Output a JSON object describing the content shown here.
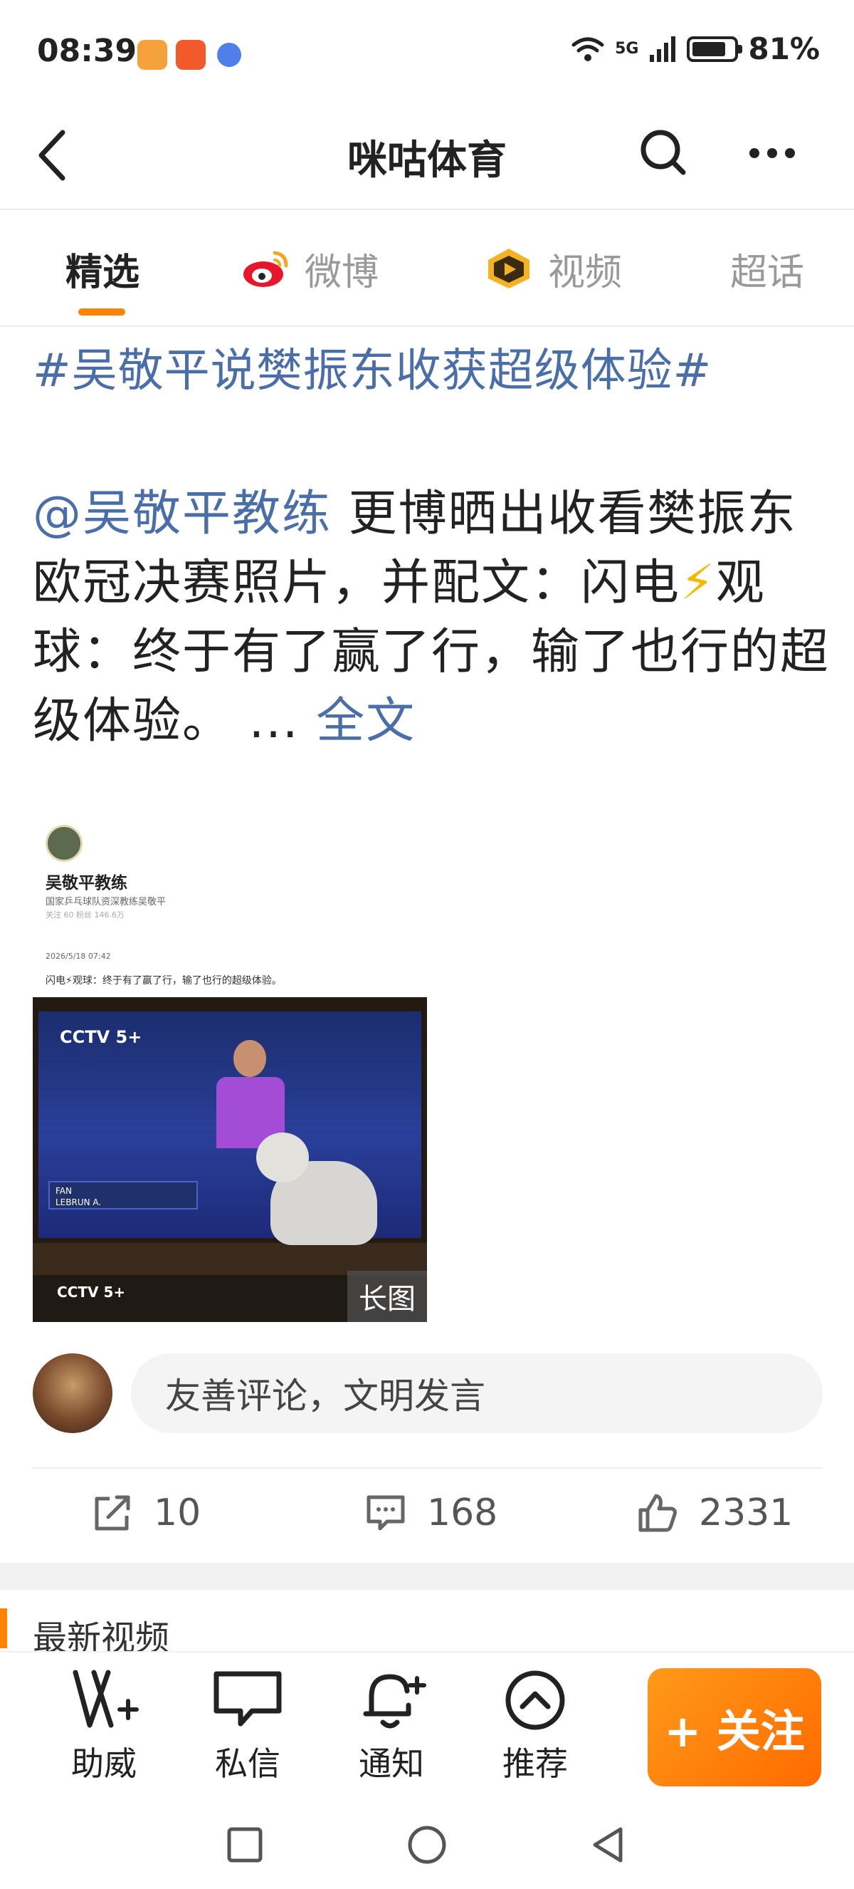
{
  "status_bar": {
    "time": "08:39",
    "network": "5G",
    "battery": "81%",
    "icons": [
      "app-badge-icon",
      "app-badge-icon",
      "app-badge-icon",
      "wifi-icon",
      "signal-icon",
      "battery-icon"
    ]
  },
  "nav": {
    "title": "咪咕体育",
    "icons": [
      "back-arrow-icon",
      "search-icon",
      "more-dots-icon"
    ]
  },
  "tabs": [
    {
      "label": "精选",
      "active": true
    },
    {
      "label": "微博",
      "icon": "weibo-icon"
    },
    {
      "label": "视频",
      "icon": "video-icon"
    },
    {
      "label": "超话"
    }
  ],
  "post": {
    "hashtag": "#吴敬平说樊振东收获超级体验#",
    "mention": "@吴敬平教练",
    "text_before_bolt": " 更博晒出收看樊振东欧冠决赛照片，并配文：闪电",
    "bolt": "⚡",
    "text_after_bolt": "观球：终于有了赢了行，输了也行的超级体验。 ...",
    "more_link": "全文"
  },
  "image": {
    "name": "吴敬平教练",
    "bio": "国家乒乓球队资深教练吴敬平",
    "stats": "关注 60   粉丝 146.6万",
    "date": "2026/5/18 07:42",
    "caption": "闪电⚡观球：终于有了赢了行，输了也行的超级体验。",
    "tv_logo": "CCTV 5+",
    "score_lines": [
      "FAN",
      "LEBRUN A."
    ],
    "foot_logo": "CCTV 5+",
    "badge": "长图"
  },
  "comment": {
    "placeholder": "友善评论，文明发言"
  },
  "actions": {
    "repost": "10",
    "comments": "168",
    "likes": "2331"
  },
  "latest": {
    "title": "最新视频"
  },
  "toolbar": {
    "items": [
      {
        "label": "助威",
        "icon": "cheer-icon"
      },
      {
        "label": "私信",
        "icon": "message-icon"
      },
      {
        "label": "通知",
        "icon": "bell-icon"
      },
      {
        "label": "推荐",
        "icon": "recommend-icon"
      }
    ],
    "follow": "+ 关注"
  },
  "colors": {
    "accent": "#ff8200",
    "link": "#4a6ea9"
  }
}
